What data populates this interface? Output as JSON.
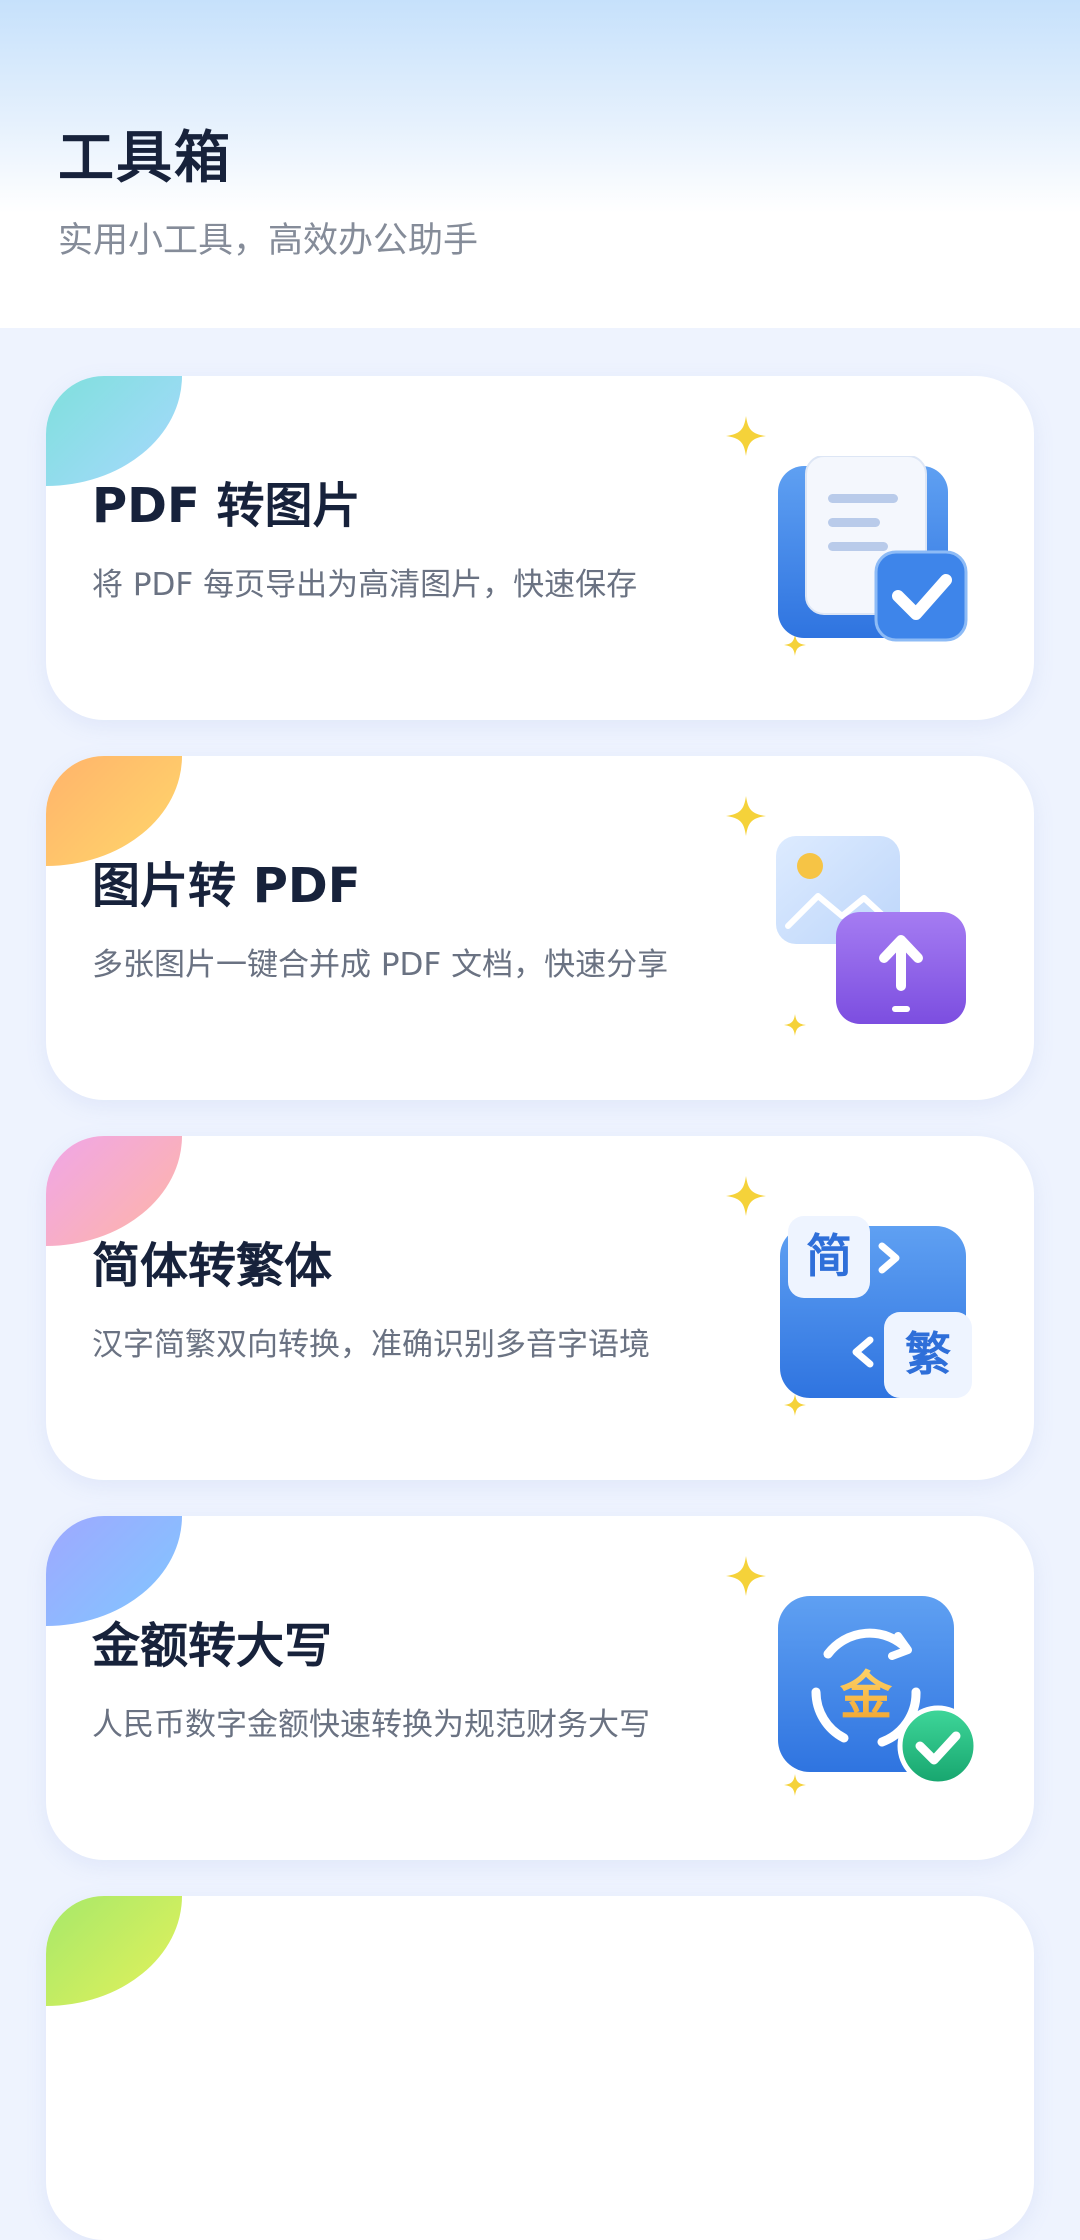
{
  "header": {
    "title": "工具箱",
    "subtitle": "实用小工具，高效办公助手"
  },
  "tools": [
    {
      "title": "PDF 转图片",
      "desc": "将 PDF 每页导出为高清图片，快速保存",
      "icon": "pdf-to-image-icon",
      "accent": [
        "#7FE0DC",
        "#A8D8FF"
      ]
    },
    {
      "title": "图片转 PDF",
      "desc": "多张图片一键合并成 PDF 文档，快速分享",
      "icon": "image-to-pdf-icon",
      "accent": [
        "#FFB36B",
        "#FFD86B"
      ]
    },
    {
      "title": "简体转繁体",
      "desc": "汉字简繁双向转换，准确识别多音字语境",
      "icon": "simplified-traditional-icon",
      "accent": [
        "#F0A6E8",
        "#FFB6A3"
      ],
      "icon_chars": [
        "简",
        "繁"
      ]
    },
    {
      "title": "金额转大写",
      "desc": "人民币数字金额快速转换为规范财务大写",
      "icon": "amount-uppercase-icon",
      "accent": [
        "#9FA8FF",
        "#7FC8FF"
      ],
      "icon_chars": [
        "金"
      ]
    }
  ],
  "colors": {
    "title": "#17223B",
    "subtitle": "#858C99",
    "background": "#EEF3FE",
    "sparkle": "#F5D23A",
    "icon_blue": "#3F86E8",
    "icon_purple": "#8E5CE6",
    "check_green": "#22B07D"
  }
}
